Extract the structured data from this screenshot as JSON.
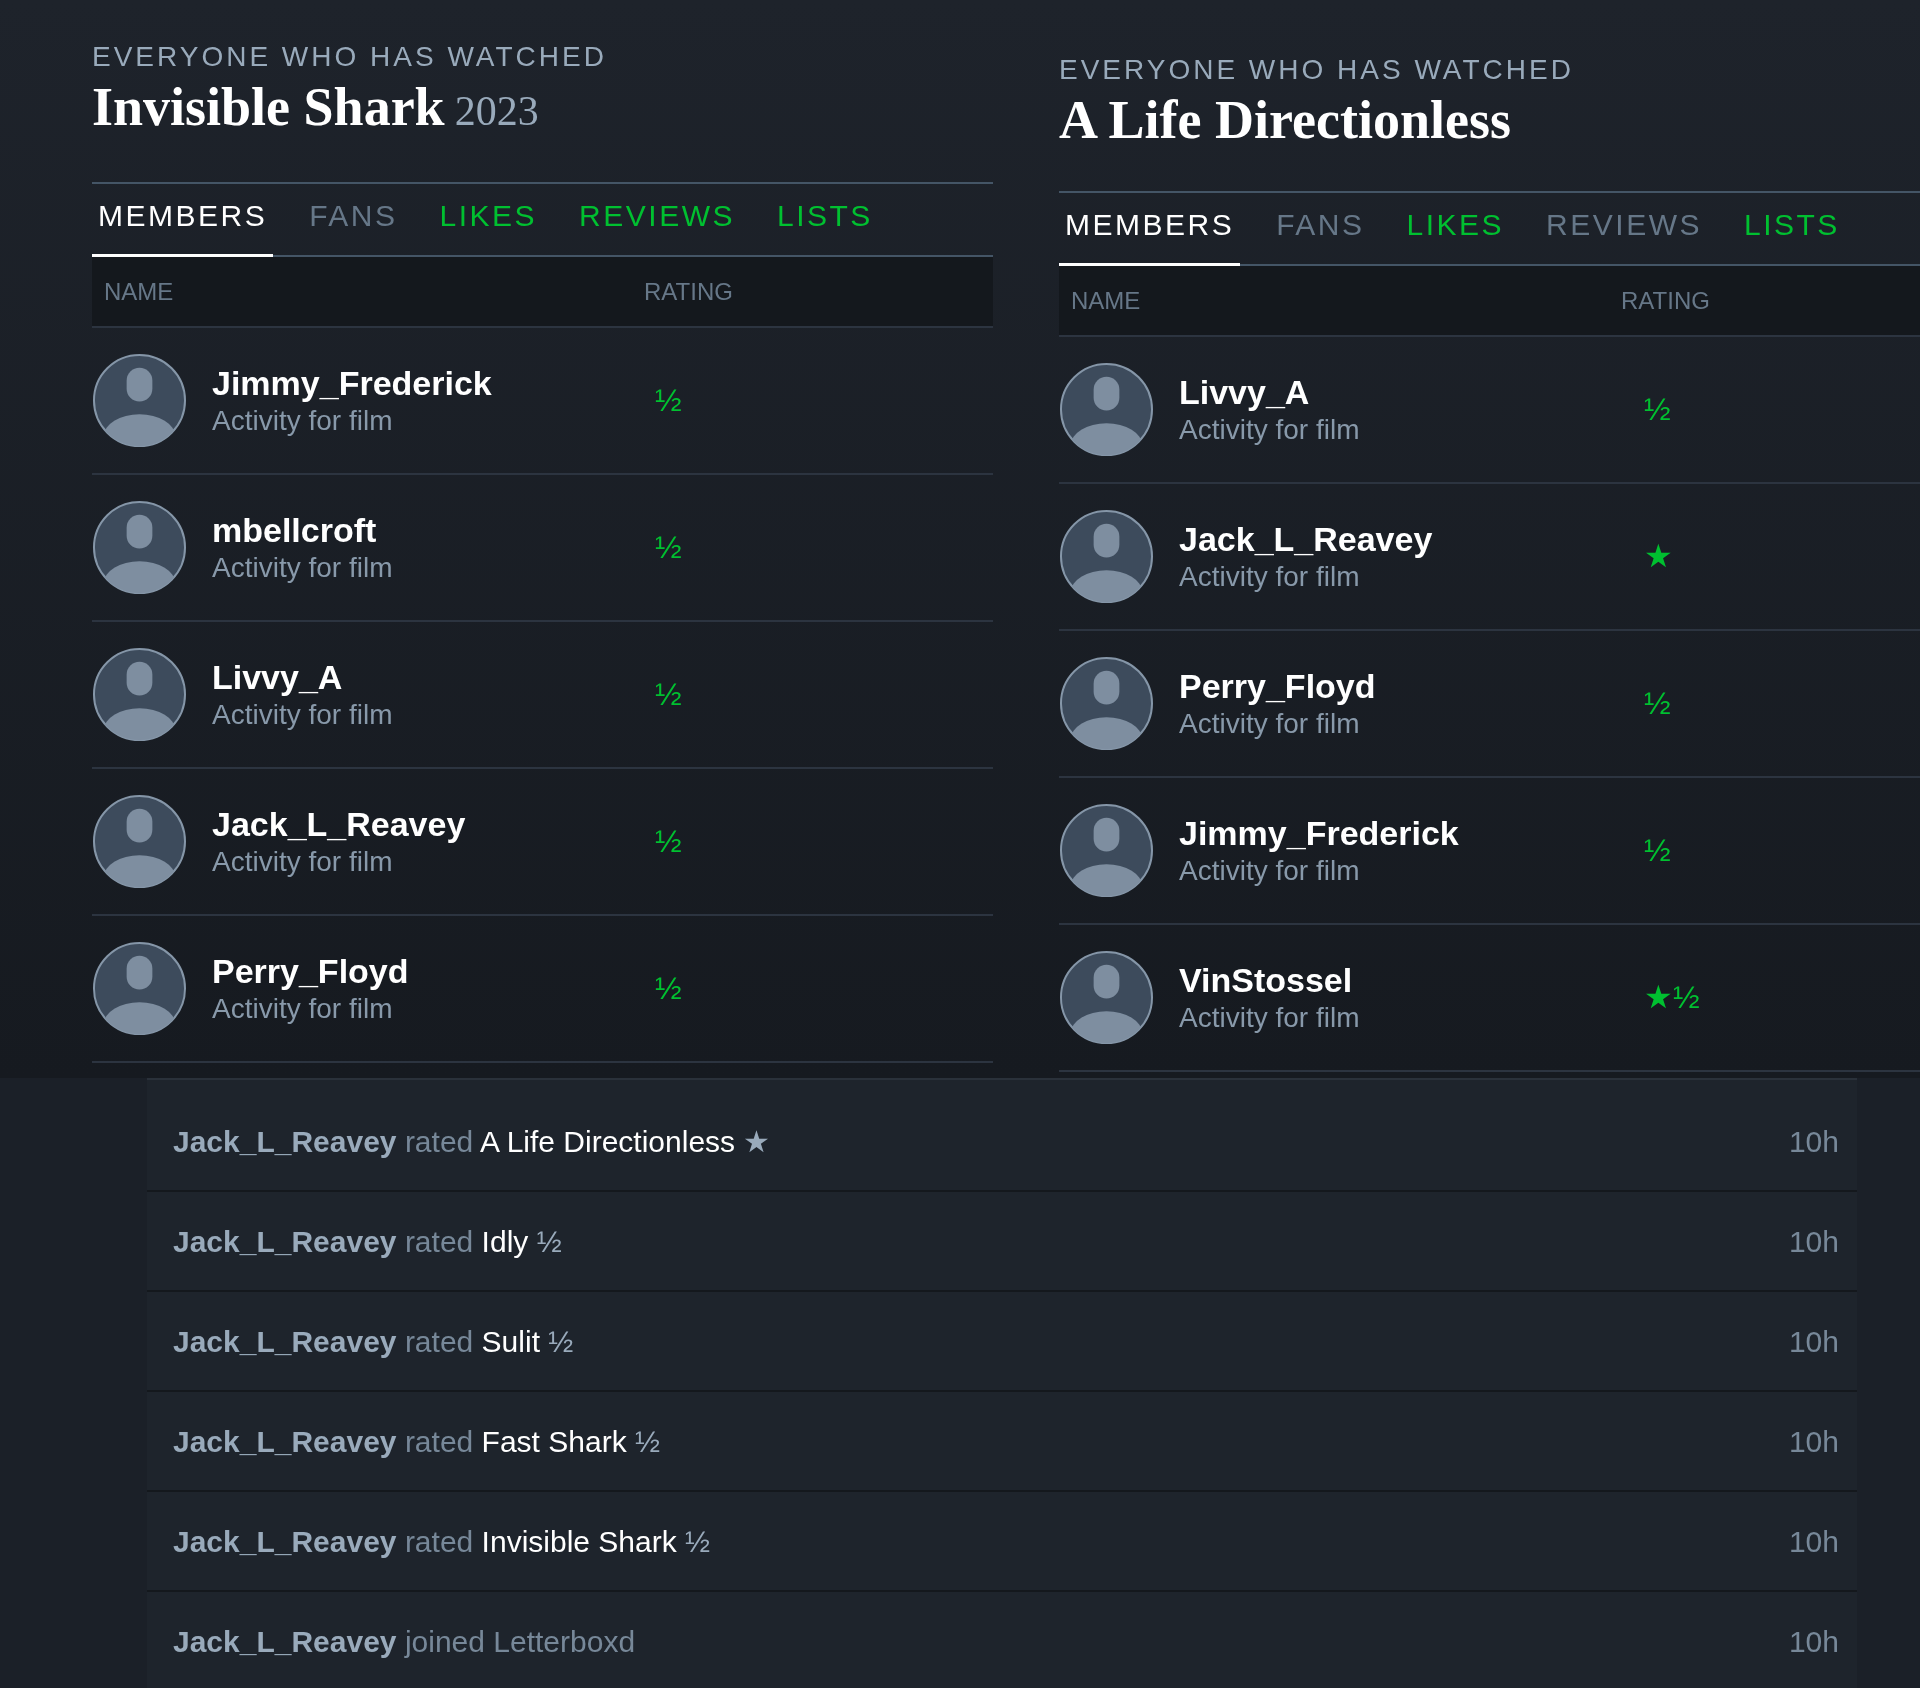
{
  "panels": [
    {
      "kicker": "EVERYONE WHO HAS WATCHED",
      "title": "Invisible Shark",
      "year": "2023",
      "tabs": [
        {
          "label": "MEMBERS",
          "selected": true,
          "highlighted": false
        },
        {
          "label": "FANS",
          "selected": false,
          "highlighted": false
        },
        {
          "label": "LIKES",
          "selected": false,
          "highlighted": true
        },
        {
          "label": "REVIEWS",
          "selected": false,
          "highlighted": true
        },
        {
          "label": "LISTS",
          "selected": false,
          "highlighted": true
        }
      ],
      "columns": [
        "NAME",
        "RATING"
      ],
      "rows": [
        {
          "name": "Jimmy_Frederick",
          "subtitle": "Activity for film",
          "rating": "½"
        },
        {
          "name": "mbellcroft",
          "subtitle": "Activity for film",
          "rating": "½"
        },
        {
          "name": "Livvy_A",
          "subtitle": "Activity for film",
          "rating": "½"
        },
        {
          "name": "Jack_L_Reavey",
          "subtitle": "Activity for film",
          "rating": "½"
        },
        {
          "name": "Perry_Floyd",
          "subtitle": "Activity for film",
          "rating": "½"
        }
      ]
    },
    {
      "kicker": "EVERYONE WHO HAS WATCHED",
      "title": "A Life Directionless",
      "tabs": [
        {
          "label": "MEMBERS",
          "selected": true,
          "highlighted": false
        },
        {
          "label": "FANS",
          "selected": false,
          "highlighted": false
        },
        {
          "label": "LIKES",
          "selected": false,
          "highlighted": true
        },
        {
          "label": "REVIEWS",
          "selected": false,
          "highlighted": false
        },
        {
          "label": "LISTS",
          "selected": false,
          "highlighted": true
        }
      ],
      "columns": [
        "NAME",
        "RATING"
      ],
      "rows": [
        {
          "name": "Livvy_A",
          "subtitle": "Activity for film",
          "rating": "½"
        },
        {
          "name": "Jack_L_Reavey",
          "subtitle": "Activity for film",
          "rating": "★"
        },
        {
          "name": "Perry_Floyd",
          "subtitle": "Activity for film",
          "rating": "½"
        },
        {
          "name": "Jimmy_Frederick",
          "subtitle": "Activity for film",
          "rating": "½"
        },
        {
          "name": "VinStossel",
          "subtitle": "Activity for film",
          "rating": "★½"
        }
      ]
    }
  ],
  "activity": [
    {
      "user": "Jack_L_Reavey",
      "verb": "rated",
      "object": "A Life Directionless",
      "rating": "★",
      "time": "10h"
    },
    {
      "user": "Jack_L_Reavey",
      "verb": "rated",
      "object": "Idly",
      "rating": "½",
      "time": "10h"
    },
    {
      "user": "Jack_L_Reavey",
      "verb": "rated",
      "object": "Sulit",
      "rating": "½",
      "time": "10h"
    },
    {
      "user": "Jack_L_Reavey",
      "verb": "rated",
      "object": "Fast Shark",
      "rating": "½",
      "time": "10h"
    },
    {
      "user": "Jack_L_Reavey",
      "verb": "rated",
      "object": "Invisible Shark",
      "rating": "½",
      "time": "10h"
    },
    {
      "user": "Jack_L_Reavey",
      "verb": "joined",
      "object": "Letterboxd",
      "time": "10h"
    }
  ]
}
